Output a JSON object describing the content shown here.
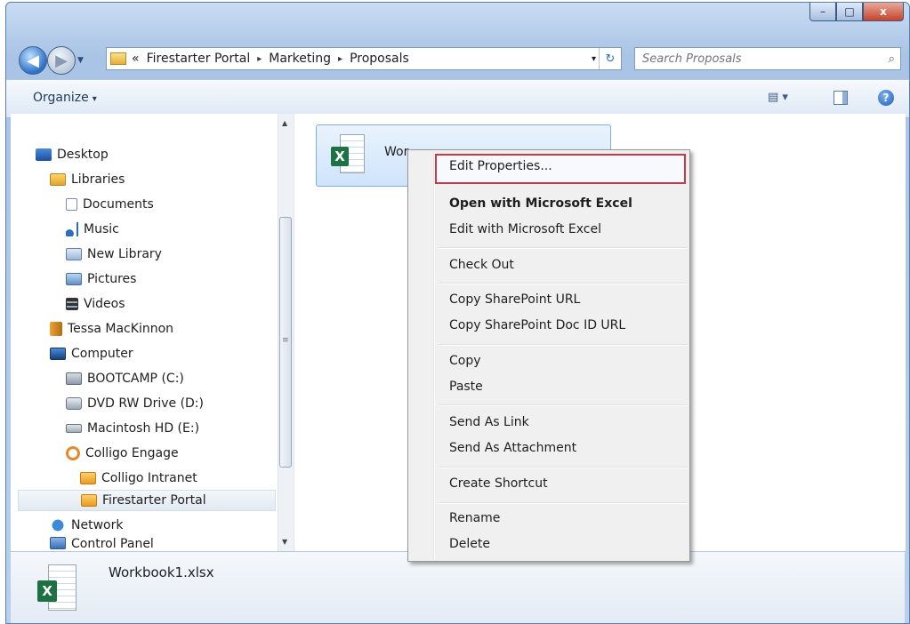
{
  "window": {
    "controls": {
      "minimize": "–",
      "maximize": "□",
      "close": "x"
    }
  },
  "navigation": {
    "back_icon": "back-arrow-icon",
    "forward_icon": "forward-arrow-icon",
    "overflow": "«",
    "breadcrumbs": [
      "Firestarter Portal",
      "Marketing",
      "Proposals"
    ],
    "separator": "▸",
    "dropdown": "▾",
    "refresh": "↻",
    "search_placeholder": "Search Proposals",
    "search_icon": "⌕"
  },
  "toolbar": {
    "organize_label": "Organize",
    "organize_arrow": "▾",
    "views_label": "▤ ▾",
    "help_label": "?"
  },
  "nav_pane": {
    "items": [
      {
        "label": "Desktop",
        "icon": "desktop-icon"
      },
      {
        "label": "Libraries",
        "icon": "libraries-icon"
      },
      {
        "label": "Documents",
        "icon": "documents-icon"
      },
      {
        "label": "Music",
        "icon": "music-icon"
      },
      {
        "label": "New Library",
        "icon": "new-library-icon"
      },
      {
        "label": "Pictures",
        "icon": "pictures-icon"
      },
      {
        "label": "Videos",
        "icon": "videos-icon"
      },
      {
        "label": "Tessa MacKinnon",
        "icon": "user-folder-icon"
      },
      {
        "label": "Computer",
        "icon": "computer-icon"
      },
      {
        "label": "BOOTCAMP (C:)",
        "icon": "drive-icon"
      },
      {
        "label": "DVD RW Drive (D:)",
        "icon": "dvd-drive-icon"
      },
      {
        "label": "Macintosh HD (E:)",
        "icon": "drive-icon"
      },
      {
        "label": "Colligo Engage",
        "icon": "colligo-icon"
      },
      {
        "label": "Colligo Intranet",
        "icon": "sharepoint-site-icon"
      },
      {
        "label": "Firestarter Portal",
        "icon": "sharepoint-site-icon"
      },
      {
        "label": "Network",
        "icon": "network-icon"
      },
      {
        "label": "Control Panel",
        "icon": "control-panel-icon"
      }
    ],
    "selected": "Firestarter Portal",
    "scroll_up": "▲",
    "scroll_down": "▼",
    "scroll_grip": "≡"
  },
  "file_pane": {
    "file_name_visible": "Wor",
    "file_icon_letter": "X"
  },
  "context_menu": {
    "items": [
      {
        "label": "Edit Properties...",
        "bold": false,
        "highlighted": true
      },
      {
        "label": "Open with Microsoft Excel",
        "bold": true
      },
      {
        "label": "Edit with Microsoft Excel",
        "bold": false
      },
      {
        "label": "Check Out",
        "bold": false
      },
      {
        "label": "Copy SharePoint URL",
        "bold": false
      },
      {
        "label": "Copy SharePoint Doc ID URL",
        "bold": false
      },
      {
        "label": "Copy",
        "bold": false
      },
      {
        "label": "Paste",
        "bold": false
      },
      {
        "label": "Send As Link",
        "bold": false
      },
      {
        "label": "Send As Attachment",
        "bold": false
      },
      {
        "label": "Create Shortcut",
        "bold": false
      },
      {
        "label": "Rename",
        "bold": false
      },
      {
        "label": "Delete",
        "bold": false
      }
    ],
    "highlight_color": "#c9394a"
  },
  "details_pane": {
    "file_name": "Workbook1.xlsx",
    "file_icon_letter": "X"
  },
  "colors": {
    "excel_green": "#1e7145",
    "selection_blue": "#cfe4fb",
    "frame_blue": "#a9c4e6"
  }
}
